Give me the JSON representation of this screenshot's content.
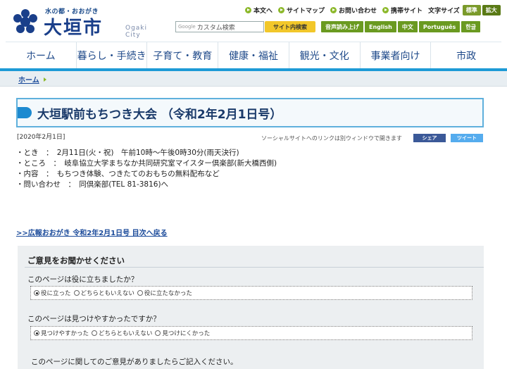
{
  "header": {
    "logo_sub": "水の都・おおがき",
    "logo_main": "大垣市",
    "logo_en": "Ogaki City",
    "toplinks": [
      "本文へ",
      "サイトマップ",
      "お問い合わせ",
      "携帯サイト"
    ],
    "fontsize_label": "文字サイズ",
    "fontsize_normal": "標準",
    "fontsize_large": "拡大",
    "search_brand": "Google",
    "search_placeholder": "カスタム検索",
    "search_button": "サイト内検索",
    "util_buttons": [
      "音声読み上げ",
      "English",
      "中文",
      "Português",
      "한글"
    ]
  },
  "gnav": [
    "ホーム",
    "暮らし・手続き",
    "子育て・教育",
    "健康・福祉",
    "観光・文化",
    "事業者向け",
    "市政"
  ],
  "breadcrumb": {
    "home": "ホーム"
  },
  "article": {
    "title": "大垣駅前もちつき大会 （令和2年2月1日号）",
    "date": "[2020年2月1日]",
    "social_note": "ソーシャルサイトへのリンクは別ウィンドウで開きます",
    "facebook_label": "シェア",
    "twitter_label": "ツイート",
    "lines": [
      "・とき　：　2月11日(火・祝)　午前10時～午後0時30分(雨天決行)",
      "・ところ　：　岐阜協立大学まちなか共同研究室マイスター倶楽部(新大橋西側)",
      "・内容　：　もちつき体験、つきたてのおもちの無料配布など",
      "・問い合わせ　：　同倶楽部(TEL 81-3816)へ"
    ],
    "back_link": ">>広報おおがき 令和2年2月1日号 目次へ戻る"
  },
  "feedback": {
    "title": "ご意見をお聞かせください",
    "q1": "このページは役に立ちましたか？",
    "q1_options": [
      "役に立った",
      "どちらともいえない",
      "役に立たなかった"
    ],
    "q1_selected": 0,
    "q2": "このページは見つけやすかったですか？",
    "q2_options": [
      "見つけやすかった",
      "どちらともいえない",
      "見つけにくかった"
    ],
    "q2_selected": 0,
    "q3": "このページに関してのご意見がありましたらご記入ください。"
  },
  "colors": {
    "brand_blue": "#1a3f8a",
    "accent_cyan": "#1d9ad6",
    "green": "#6a9a20",
    "yellow": "#f2c72a"
  }
}
